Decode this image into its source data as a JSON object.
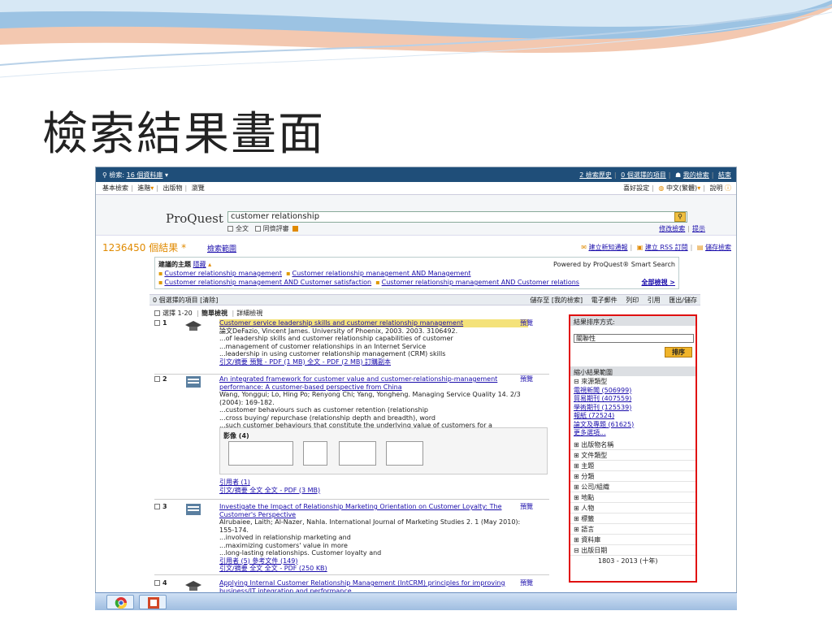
{
  "slide_title": "檢索結果畫面",
  "topbar": {
    "search_label": "檢索:",
    "db_link": "16 個資料庫",
    "right": [
      "2 檢索歷史",
      "0 個選擇的項目",
      "我的檢索",
      "結束"
    ]
  },
  "navbar": {
    "left": [
      "基本檢索",
      "進階",
      "出版物",
      "瀏覽"
    ],
    "right": [
      "喜好設定",
      "中文(繁體)",
      "說明"
    ]
  },
  "search": {
    "logo": "ProQuest",
    "query": "customer relationship",
    "opt_fulltext": "全文",
    "opt_peer": "同儕評審",
    "modify": "修改檢索",
    "tips": "提示"
  },
  "results_header": {
    "count": "1236450",
    "count_suffix": "個結果",
    "scope": "檢索範圍",
    "actions": [
      "建立新知通報",
      "建立 RSS 訂閱",
      "儲存檢索"
    ]
  },
  "suggest": {
    "label": "建議的主題",
    "hide": "隱藏",
    "powered": "Powered by ProQuest® Smart Search",
    "row1": [
      "Customer relationship management",
      "Customer relationship management AND Management"
    ],
    "row2": [
      "Customer relationship management AND Customer satisfaction",
      "Customer relationship management AND Customer relations"
    ],
    "browse_all": "全部檢視 >"
  },
  "actionbar": {
    "left": "0 個選擇的項目 [清除]",
    "right": [
      "儲存至 [我的檢索]",
      "電子郵件",
      "列印",
      "引用",
      "匯出/儲存"
    ]
  },
  "selectrow": {
    "select": "選擇 1-20",
    "simple": "簡單檢視",
    "detail": "詳細檢視"
  },
  "results": [
    {
      "num": "1",
      "title": "Customer service leadership skills and customer relationship management",
      "meta": "論文DeFazio, Vincent James. University of Phoenix, 2003. 2003. 3106492.",
      "snips": [
        "...of leadership skills and customer relationship capabilities of customer",
        "...management of customer relationships in an Internet Service",
        "...leadership in using customer relationship management (CRM) skills"
      ],
      "links": "引文/摘要   預覽 - PDF (1 MB)   全文 - PDF (2 MB)   訂購副本",
      "preview": "預覽"
    },
    {
      "num": "2",
      "title": "An integrated framework for customer value and customer-relationship-management performance: A customer-based perspective from China",
      "meta": "Wang, Yonggui; Lo, Hing Po; Renyong Chi; Yang, Yongheng. Managing Service Quality 14. 2/3 (2004): 169-182.",
      "snips": [
        "...customer behaviours such as customer retention (relationship",
        "...cross buying/ repurchase (relationship depth and breadth), word",
        "...such customer behaviours that constitute the underlying value of customers for a"
      ],
      "images_label": "影像 (4)",
      "cited": "引用者 (1)",
      "links": "引文/摘要   全文   全文 - PDF (3 MB)",
      "preview": "預覽"
    },
    {
      "num": "3",
      "title": "Investigate the Impact of Relationship Marketing Orientation on Customer Loyalty: The Customer's Perspective",
      "meta": "Alrubaiee, Laith; Al-Nazer, Nahla. International Journal of Marketing Studies 2. 1 (May 2010): 155-174.",
      "snips": [
        "...involved in relationship marketing and",
        "...maximizing customers' value in more",
        "...long-lasting relationships. Customer loyalty and"
      ],
      "cited": "引用者 (5)   參考文件 (149)",
      "links": "引文/摘要   全文   全文 - PDF (250 KB)",
      "preview": "預覽"
    },
    {
      "num": "4",
      "title": "Applying Internal Customer Relationship Management (IntCRM) principles for improving business/IT integration and performance",
      "preview": "預覽"
    }
  ],
  "sidebar": {
    "sort_header": "結果排序方式:",
    "sort_value": "關聯性",
    "sort_button": "排序",
    "narrow_header": "縮小結果範圍",
    "source_type": "來源類型",
    "sources": [
      "電視新聞 (506999)",
      "貿易期刊 (407559)",
      "學術期刊 (125539)",
      "報紙 (72524)",
      "論文及專題 (61625)"
    ],
    "more": "更多選項...",
    "facets": [
      "出版物名稱",
      "文件類型",
      "主題",
      "分類",
      "公司/組織",
      "地點",
      "人物",
      "標籤",
      "語言",
      "資料庫"
    ],
    "date_facet": "出版日期",
    "date_range": "1803 - 2013 (十年)"
  }
}
